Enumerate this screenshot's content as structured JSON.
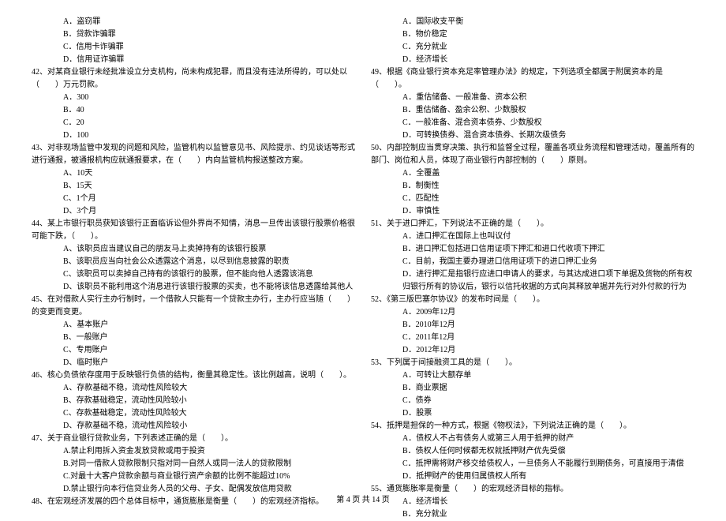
{
  "col1": {
    "q41_opts": [
      "A．盗窃罪",
      "B．贷款诈骗罪",
      "C．信用卡诈骗罪",
      "D．信用证诈骗罪"
    ],
    "q42": "42、对某商业银行未经批准设立分支机构，尚未构成犯罪，而且没有违法所得的，可以处以（　　）万元罚款。",
    "q42_opts": [
      "A．300",
      "B．40",
      "C．20",
      "D．100"
    ],
    "q43": "43、对非现场监管中发现的问题和风险，监管机构以监管意见书、风险提示、约见谈话等形式进行通报，被通报机构应就通报要求，在（　　）内向监管机构报送整改方案。",
    "q43_opts": [
      "A、10天",
      "B、15天",
      "C、1个月",
      "D、3个月"
    ],
    "q44": "44、某上市银行职员获知该银行正面临诉讼但外界尚不知情，消息一旦传出该银行股票价格很可能下跌，（　　）。",
    "q44_opts": [
      "A、该职员应当建议自己的朋友马上卖掉持有的该银行股票",
      "B、该职员应当向社会公众透露这个消息，以尽到信息披露的职责",
      "C、该职员可以卖掉自己持有的该银行的股票，但不能向他人透露该消息",
      "D、该职员不能利用这个消息进行该银行股票的买卖，也不能将该信息透露给其他人"
    ],
    "q45": "45、在对借款人实行主办行制时，一个借款人只能有一个贷款主办行，主办行应当随（　　）的变更而变更。",
    "q45_opts": [
      "A、基本账户",
      "B、一般账户",
      "C、专用账户",
      "D、临时账户"
    ],
    "q46": "46、核心负债依存度用于反映银行负债的结构，衡量其稳定性。该比例越高，说明（　　）。",
    "q46_opts": [
      "A、存款基础不稳，流动性风险较大",
      "B、存款基础稳定，流动性风险较小",
      "C、存款基础稳定，流动性风险较大",
      "D、存款基础不稳，流动性风险较小"
    ],
    "q47": "47、关于商业银行贷款业务，下列表述正确的是（　　）。",
    "q47_opts": [
      "A.禁止利用拆入资金发放贷款或用于投资",
      "B.对同一借款人贷款限制只指对同一自然人或同一法人的贷款限制",
      "C.对最十大客户贷款余额与商业银行资产余额的比例不能超过10%",
      "D.禁止银行向本行信贷业务人员的父母、子女、配偶发放信用贷款"
    ],
    "q48": "48、在宏观经济发展的四个总体目标中，通货膨胀是衡量（　　）的宏观经济指标。"
  },
  "col2": {
    "q48_opts": [
      "A．国际收支平衡",
      "B．物价稳定",
      "C．充分就业",
      "D．经济增长"
    ],
    "q49": "49、根据《商业银行资本充足率管理办法》的规定，下列选项全都属于附属资本的是（　　）。",
    "q49_opts": [
      "A．重估储备、一般准备、资本公积",
      "B．重估储备、盈余公积、少数股权",
      "C．一般准备、混合资本债券、少数股权",
      "D．可转换债券、混合资本债券、长期次级债务"
    ],
    "q50": "50、内部控制应当贯穿决策、执行和监督全过程，覆盖各项业务流程和管理活动，覆盖所有的部门、岗位和人员，体现了商业银行内部控制的（　　）原则。",
    "q50_opts": [
      "A．全覆盖",
      "B．制衡性",
      "C．匹配性",
      "D．审慎性"
    ],
    "q51": "51、关于进口押汇，下列说法不正确的是（　　）。",
    "q51_opts": [
      "A．进口押汇在国际上也叫议付",
      "B．进口押汇包括进口信用证项下押汇和进口代收项下押汇",
      "C．目前，我国主要办理进口信用证项下的进口押汇业务",
      "D．进行押汇是指银行应进口申请人的要求，与其达成进口项下单据及货物的所有权归银行所有的协议后，银行以信托收据的方式向其释放单据并先行对外付款的行为"
    ],
    "q52": "52、《第三版巴塞尔协议》的发布时间是（　　）。",
    "q52_opts": [
      "A．2009年12月",
      "B．2010年12月",
      "C．2011年12月",
      "D．2012年12月"
    ],
    "q53": "53、下列属于间接融资工具的是（　　）。",
    "q53_opts": [
      "A．可转让大额存单",
      "B．商业票据",
      "C．债券",
      "D．股票"
    ],
    "q54": "54、抵押是担保的一种方式，根据《物权法》，下列说法正确的是（　　）。",
    "q54_opts": [
      "A．债权人不占有债务人或第三人用于抵押的财产",
      "B．债权人任何时候都无权就抵押财产优先受偿",
      "C．抵押需将财产移交给债权人，一旦债务人不能履行到期债务，可直接用于清偿",
      "D．抵押财产的使用归属债权人所有"
    ],
    "q55": "55、通货膨胀率是衡量（　　）的宏观经济目标的指标。",
    "q55_opts": [
      "A．经济增长",
      "B．充分就业"
    ]
  },
  "footer": "第 4 页 共 14 页"
}
